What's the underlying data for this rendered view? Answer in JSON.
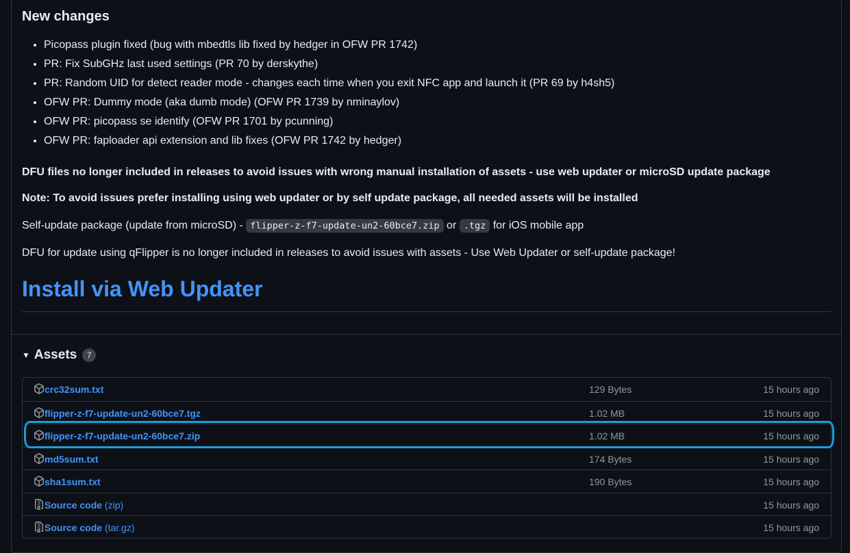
{
  "notes": {
    "heading": "New changes",
    "changes": [
      "Picopass plugin fixed (bug with mbedtls lib fixed by hedger in OFW PR 1742)",
      "PR: Fix SubGHz last used settings (PR 70 by derskythe)",
      "PR: Random UID for detect reader mode - changes each time when you exit NFC app and launch it (PR 69 by h4sh5)",
      "OFW PR: Dummy mode (aka dumb mode) (OFW PR 1739 by nminaylov)",
      "OFW PR: picopass se identify (OFW PR 1701 by pcunning)",
      "OFW PR: faploader api extension and lib fixes (OFW PR 1742 by hedger)"
    ],
    "dfu_note": "DFU files no longer included in releases to avoid issues with wrong manual installation of assets - use web updater or microSD update package",
    "note": "Note: To avoid issues prefer installing using web updater or by self update package, all needed assets will be installed",
    "self_update": {
      "prefix": "Self-update package (update from microSD) - ",
      "zip_code": "flipper-z-f7-update-un2-60bce7.zip",
      "or": " or ",
      "tgz_code": ".tgz",
      "suffix": " for iOS mobile app"
    },
    "qflipper_note": "DFU for update using qFlipper is no longer included in releases to avoid issues with assets - Use Web Updater or self-update package!",
    "install_link": "Install via Web Updater"
  },
  "assets": {
    "title": "Assets",
    "count": "7",
    "rows": [
      {
        "icon": "package-icon",
        "name": "crc32sum.txt",
        "suffix": "",
        "size": "129 Bytes",
        "time": "15 hours ago"
      },
      {
        "icon": "package-icon",
        "name": "flipper-z-f7-update-un2-60bce7.tgz",
        "suffix": "",
        "size": "1.02 MB",
        "time": "15 hours ago"
      },
      {
        "icon": "package-icon",
        "name": "flipper-z-f7-update-un2-60bce7.zip",
        "suffix": "",
        "size": "1.02 MB",
        "time": "15 hours ago"
      },
      {
        "icon": "package-icon",
        "name": "md5sum.txt",
        "suffix": "",
        "size": "174 Bytes",
        "time": "15 hours ago"
      },
      {
        "icon": "package-icon",
        "name": "sha1sum.txt",
        "suffix": "",
        "size": "190 Bytes",
        "time": "15 hours ago"
      },
      {
        "icon": "file-zip-icon",
        "name": "Source code",
        "suffix": " (zip)",
        "size": "",
        "time": "15 hours ago"
      },
      {
        "icon": "file-zip-icon",
        "name": "Source code",
        "suffix": " (tar.gz)",
        "size": "",
        "time": "15 hours ago"
      }
    ]
  },
  "colors": {
    "background": "#0d1117",
    "link": "#4493f8",
    "muted": "#9198a1",
    "highlight": "#1a9fd9"
  }
}
